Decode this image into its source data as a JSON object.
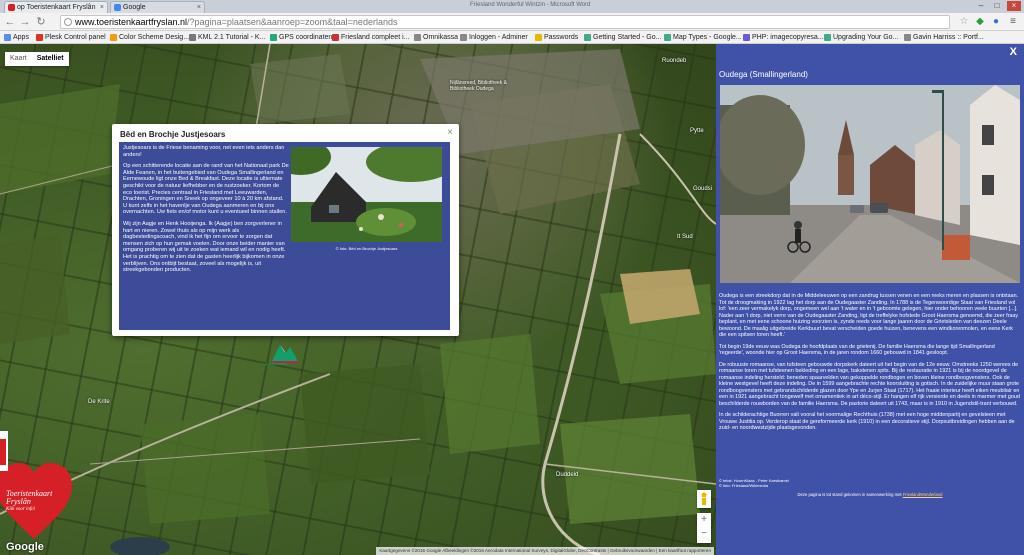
{
  "browser": {
    "tabs": [
      {
        "title": "op Toeristenkaart Fryslân"
      },
      {
        "title": "Google"
      }
    ],
    "window_title": "Friesland Wonderful Wintzin - Microsoft Word",
    "url_domain": "www.toeristenkaartfryslan.nl",
    "url_path": "/?pagina=plaatsen&aanroep=zoom&taal=nederlands",
    "bookmarks": [
      "Apps",
      "Plesk Control panel",
      "Color Scheme Desig...",
      "KML 2.1 Tutorial - K...",
      "GPS coordinaten",
      "Friesland compleet i...",
      "Omnikassa",
      "Inloggen - Adminer",
      "Passwords",
      "Getting Started - Go...",
      "Map Types - Google...",
      "PHP: imagecopyresa...",
      "Upgrading Your Go...",
      "Gavin Harriss :: Portf..."
    ]
  },
  "map": {
    "type_control": {
      "map_label": "Kaart",
      "satellite_label": "Satelliet"
    },
    "labels": [
      "Nijlânsreed, Bibliotheek & Bibliotheek Oudega",
      "Ruondeb",
      "Goudsi",
      "Pytte",
      "It Sud",
      "De Krite",
      "Duddeld"
    ],
    "google_logo": "Google",
    "attribution": "Kaartgegevens ©2016 Google Afbeeldingen ©2016 Aerodata International Surveys, DigitalGlobe, DeoContrasts | Gebruiksvoorwaarden | Een kaartfout rapporteren",
    "logo_text": [
      "Toeristenkaart",
      "Fryslân",
      "Klik voor info!"
    ]
  },
  "popup": {
    "title": "Bêd en Brochje Justjesoars",
    "paragraphs": [
      "Justjesoars is de Friese benaming voor, net even iets anders dan anders!",
      "Op een schitterende locatie aan de rand van het Nationaal park De Alde Feanen, in het buitengebied van Oudega Smallingerland en Eernewoude ligt onze Bed & Breakfast. Deze locatie is ultiemate geschikt voor de natuur liefhebber en de rustzoeker. Kortom de eco toerist. Precies centraal in Friesland met Leeuwarden, Drachten, Groningen en Sneek op ongeveer 10 à 20 km afstand. U kunt zelfs in het havenlje van Oudega aanmeren en bij ons overnachten. Uw fiets en/of motor kunt u eventueel binnen stallen.",
      "Wij zijn Aagje en Henk Hooijenga. Ik (Aagje) ben zorgverlener in hart en nieren. Zowel thuis als op mijn werk als dagbestedingscoach, vind ik het fijn om ervoor te zorgen dat mensen zich op hun gemak voelen. Door onze beider manier van omgang proberen wij uit te zoeken wat iemand wil en nodig heeft. Het is prachtig om te zien dat de gasten heerlijk bijkomen in onze verblijven. Ons ontbijt bestaat, zoveel als mogelijk is, uit streekgebonden producten."
    ],
    "photo_credit": "© foto: Bêd en Brochje Justjesoars",
    "close_label": "×"
  },
  "marker": {
    "label": "Justjesoars"
  },
  "panel": {
    "close_label": "X",
    "title": "Oudega (Smallingerland)",
    "paragraphs": [
      "Oudega is een streekdorp dat in de Middeleeuwen op een zandrug tussen venen en een reeks meren en plassen is ontstaan. Tot de droogmaking in 1922 lag het dorp aan de Oudegaaster Zanding. In 1788 is de Tegenwoordige Staat van Friesland vol lof: 'een zeer vermakelyk dorp, ongemeen wel aan 't water en in 't geboomte gelegen, hier onder behooren veele buurten [...]. Nader aan 't dorp, niet verre van de Oudegaaster Zanding, ligt de treffelyke hofstede Groot Haersma genoemd, die zeer fraay beplant, en met eene schoone huizing voorzien is, zynde reeds voor lange jaaren door de Grietsleden van deezen Deele bewoond. De maalig uitgebreide Kerkbuurt bevat verscheiden goede huizen, benevens een windkorenmolen, en eene Kerk die een spitsen toren heeft.'",
      "Tot begin 19de eeuw was Oudega de hoofdplaats van de grietenij. De familie Haersma die lange tijd Smallingerland 'regeerde', woonde hier op Groot Haersma, in de jaren rondom 1660 gebouwd in 1841 gesloopt.",
      "De robuuste romaanse, van tufsteen gebouwde dorpskerk dateert uit het begin van de 12e eeuw. Omstreeks 1250 werees de romaanse toren met tufsteenen bekleding en een lage, bakstenen spits. Bij de restauratie in 1921 is bij de noordgevel de romaanse indeling hersteld: beneden spaarvelden van gekoppelde rondbogen en boven kleine rondboogvensters. Ook de kleine westgevel heeft deze indeling. De in 1599 aangebrachte rechte koorsluiting is gotisch. In de zuidelijke muur staan grote rondboogvensters met gebrandschilderde glazen door Ype en Jurjen Staal (1717). Het fraaie interieur heeft eiken meubilair en een in 1921 aangebracht tongewelf met ornamentiek in art déco-stijl. Er hangen elf rijk versierde en deels in marmer met goud beschilderde rouwborden van de familie Haersma. De pastorie dateert uit 1743, maar is in 1910 in Jugendstil-trant verbouwd.",
      "In de schilderachtige Buorren valt vooral het voormalige Rechthuis (1738) met een hoge middenpartij en gevelsteen met Vrouwe Justitia op. Verderop staat de gereformeerde kerk (1910) in een decoratieve stijl. Dorpsuitbreidingen hebben aan de zuid- en noordwestzijde plaatsgevonden."
    ],
    "credits": [
      "© tekst: HoornKlaas - Peter Karstkamel",
      "© foto: Friesland/Wikimedia"
    ],
    "footer_prefix": "Deze pagina is tot stand gekomen in samenwerking met",
    "footer_link": "FrieslandWonderland"
  },
  "colors": {
    "panel_bg": "#3f52a8",
    "popup_inner_bg": "#3c4c99",
    "logo_red": "#d62027"
  }
}
